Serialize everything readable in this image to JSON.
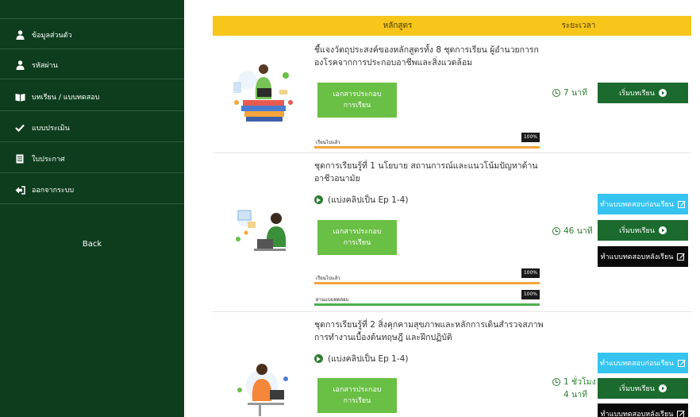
{
  "sidebar": {
    "items": [
      {
        "label": "ข้อมูลส่วนตัว",
        "icon": "user-icon"
      },
      {
        "label": "รหัสผ่าน",
        "icon": "user-icon"
      },
      {
        "label": "บทเรียน / แบบทดสอบ",
        "icon": "book-icon"
      },
      {
        "label": "แบบประเมิน",
        "icon": "check-icon"
      },
      {
        "label": "ใบประกาศ",
        "icon": "certificate-icon"
      },
      {
        "label": "ออกจากระบบ",
        "icon": "sign-out-icon"
      }
    ],
    "back_label": "Back"
  },
  "table": {
    "header_course": "หลักสูตร",
    "header_time": "ระยะเวลา"
  },
  "rows": [
    {
      "title": "ชี้แจงวัตถุประสงค์ของหลักสูตรทั้ง 8 ชุดการเรียน ผู้อำนวยการกองโรคจากการประกอบอาชีพและสิ่งแวดล้อม",
      "doc_button": "เอกสารประกอบการเรียน",
      "progress": [
        {
          "label": "เรียนไปแล้ว",
          "percent_label": "100%",
          "value": 100,
          "color": "orange"
        }
      ],
      "duration": "7 นาที",
      "actions": [
        {
          "label": "เริ่มบทเรียน",
          "style": "green",
          "icon": "play-circle-icon"
        }
      ]
    },
    {
      "title": "ชุดการเรียนรู้ที่ 1 นโยบาย สถานการณ์และแนวโน้มปัญหาด้านอาชีวอนามัย",
      "clip": "(แบ่งคลิปเป็น Ep 1-4)",
      "doc_button": "เอกสารประกอบการเรียน",
      "progress": [
        {
          "label": "เรียนไปแล้ว",
          "percent_label": "100%",
          "value": 100,
          "color": "orange"
        },
        {
          "label": "ผ่านแบบทดสอบ",
          "percent_label": "100%",
          "value": 100,
          "color": "green"
        }
      ],
      "duration": "46 นาที",
      "actions": [
        {
          "label": "ทำแบบทดสอบก่อนเรียน",
          "style": "cyan",
          "icon": "edit-icon"
        },
        {
          "label": "เริ่มบทเรียน",
          "style": "green",
          "icon": "play-circle-icon"
        },
        {
          "label": "ทำแบบทดสอบหลังเรียน",
          "style": "black",
          "icon": "edit-icon"
        }
      ]
    },
    {
      "title": "ชุดการเรียนรู้ที่ 2 สิ่งคุกคามสุขภาพและหลักการเดินสำรวจสภาพการทำงานเบื้องต้นทฤษฎี และฝึกปฏิบัติ",
      "clip": "(แบ่งคลิปเป็น Ep 1-4)",
      "doc_button": "เอกสารประกอบการเรียน",
      "duration_line1": "1 ชั่วโมง",
      "duration_line2": "4 นาที",
      "actions": [
        {
          "label": "ทำแบบทดสอบก่อนเรียน",
          "style": "cyan",
          "icon": "edit-icon"
        },
        {
          "label": "เริ่มบทเรียน",
          "style": "green",
          "icon": "play-circle-icon"
        },
        {
          "label": "ทำแบบทดสอบหลังเรียน",
          "style": "black",
          "icon": "edit-icon"
        }
      ]
    }
  ]
}
